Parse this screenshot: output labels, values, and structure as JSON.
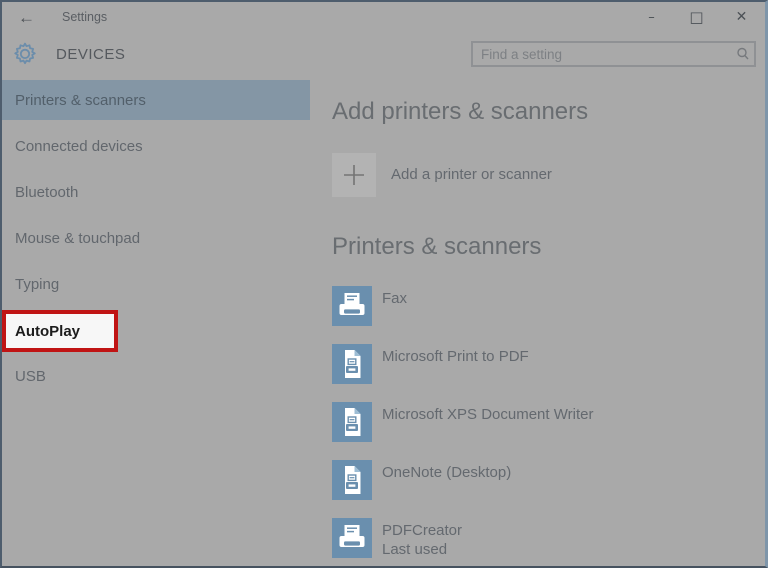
{
  "window": {
    "title": "Settings",
    "back_glyph": "←",
    "controls": {
      "minimize_glyph": "–",
      "maximize_glyph": "□",
      "close_glyph": "✕"
    }
  },
  "header": {
    "page_title": "DEVICES",
    "search": {
      "placeholder": "Find a setting"
    }
  },
  "sidebar": {
    "items": [
      {
        "label": "Printers & scanners",
        "selected": true
      },
      {
        "label": "Connected devices",
        "selected": false
      },
      {
        "label": "Bluetooth",
        "selected": false
      },
      {
        "label": "Mouse & touchpad",
        "selected": false
      },
      {
        "label": "Typing",
        "selected": false
      },
      {
        "label": "AutoPlay",
        "selected": false,
        "annotated": true
      },
      {
        "label": "USB",
        "selected": false
      }
    ]
  },
  "main": {
    "add_section_title": "Add printers & scanners",
    "add_button_label": "Add a printer or scanner",
    "list_section_title": "Printers & scanners",
    "printers": [
      {
        "name": "Fax",
        "subtitle": "",
        "icon": "printer-icon"
      },
      {
        "name": "Microsoft Print to PDF",
        "subtitle": "",
        "icon": "document-icon"
      },
      {
        "name": "Microsoft XPS Document Writer",
        "subtitle": "",
        "icon": "document-icon"
      },
      {
        "name": "OneNote (Desktop)",
        "subtitle": "",
        "icon": "document-icon"
      },
      {
        "name": "PDFCreator",
        "subtitle": "Last used",
        "icon": "printer-icon"
      }
    ]
  },
  "colors": {
    "window_bg": "#a9a9a9",
    "selected_highlight": "#8496a5",
    "device_icon_blue": "#6a8fae",
    "annotation_red": "#c01414",
    "annotation_bg": "#f7f7f7",
    "window_border": "#4e5d6d"
  }
}
